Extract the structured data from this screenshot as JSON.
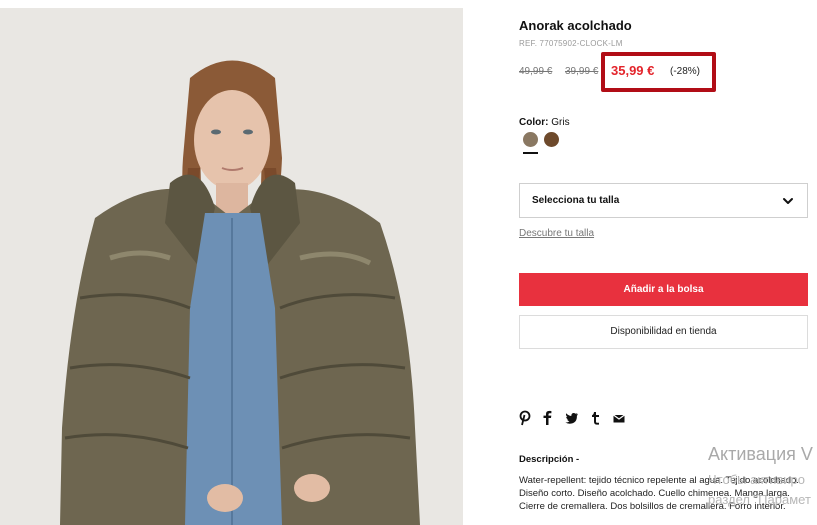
{
  "product": {
    "title": "Anorak acolchado",
    "ref": "REF. 77075902-CLOCK-LM",
    "old_price_1": "49,99 €",
    "old_price_2": "39,99 €",
    "price": "35,99 €",
    "discount": "(-28%)",
    "price_color": "#e3242b"
  },
  "color": {
    "label": "Color:",
    "value": "Gris",
    "swatches": [
      {
        "name": "Gris",
        "hex": "#8a7862",
        "selected": true
      },
      {
        "name": "brown",
        "hex": "#6e4a2c",
        "selected": false
      }
    ]
  },
  "size": {
    "select_label": "Selecciona tu talla",
    "guide_link": "Descubre tu talla"
  },
  "actions": {
    "add_to_bag": "Añadir a la bolsa",
    "store_availability": "Disponibilidad en tienda",
    "accent": "#e8313e"
  },
  "share_icons": [
    "pinterest-icon",
    "facebook-icon",
    "twitter-icon",
    "tumblr-icon",
    "mail-icon"
  ],
  "description": {
    "title": "Descripción -",
    "text": "Water-repellent: tejido técnico repelente al agua. Tejido acolchado. Diseño corto. Diseño acolchado. Cuello chimenea. Manga larga. Cierre de cremallera. Dos bolsillos de cremallera. Forro interior."
  },
  "overlay": {
    "line1": "Активация V",
    "line2": "Чтобы активиро",
    "line3": "раздел \"Парамет"
  }
}
